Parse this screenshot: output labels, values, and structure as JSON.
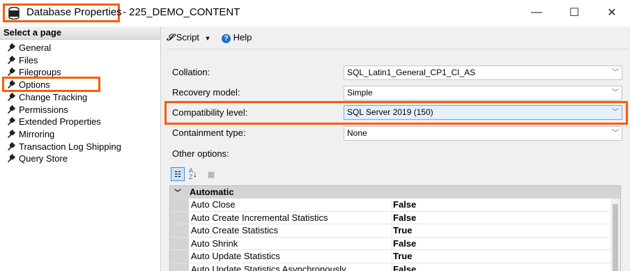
{
  "window": {
    "title": "Database Properties",
    "title_suffix": "- 225_DEMO_CONTENT",
    "controls": {
      "minimize": "—",
      "maximize": "☐",
      "close": "✕"
    }
  },
  "sidebar": {
    "header": "Select a page",
    "items": [
      {
        "label": "General"
      },
      {
        "label": "Files"
      },
      {
        "label": "Filegroups"
      },
      {
        "label": "Options",
        "selected": true
      },
      {
        "label": "Change Tracking"
      },
      {
        "label": "Permissions"
      },
      {
        "label": "Extended Properties"
      },
      {
        "label": "Mirroring"
      },
      {
        "label": "Transaction Log Shipping"
      },
      {
        "label": "Query Store"
      }
    ]
  },
  "toolbar": {
    "script_label": "Script",
    "help_label": "Help"
  },
  "form": {
    "collation": {
      "label": "Collation:",
      "value": "SQL_Latin1_General_CP1_CI_AS"
    },
    "recovery_model": {
      "label": "Recovery model:",
      "value": "Simple"
    },
    "compatibility_level": {
      "label": "Compatibility level:",
      "value": "SQL Server 2019 (150)"
    },
    "containment_type": {
      "label": "Containment type:",
      "value": "None"
    },
    "other_options_label": "Other options:"
  },
  "property_grid": {
    "category": "Automatic",
    "rows": [
      {
        "name": "Auto Close",
        "value": "False"
      },
      {
        "name": "Auto Create Incremental Statistics",
        "value": "False"
      },
      {
        "name": "Auto Create Statistics",
        "value": "True"
      },
      {
        "name": "Auto Shrink",
        "value": "False"
      },
      {
        "name": "Auto Update Statistics",
        "value": "True"
      },
      {
        "name": "Auto Update Statistics Asynchronously",
        "value": "False"
      }
    ]
  },
  "colors": {
    "highlight": "#ff5a0a",
    "accent": "#1a73c8"
  }
}
